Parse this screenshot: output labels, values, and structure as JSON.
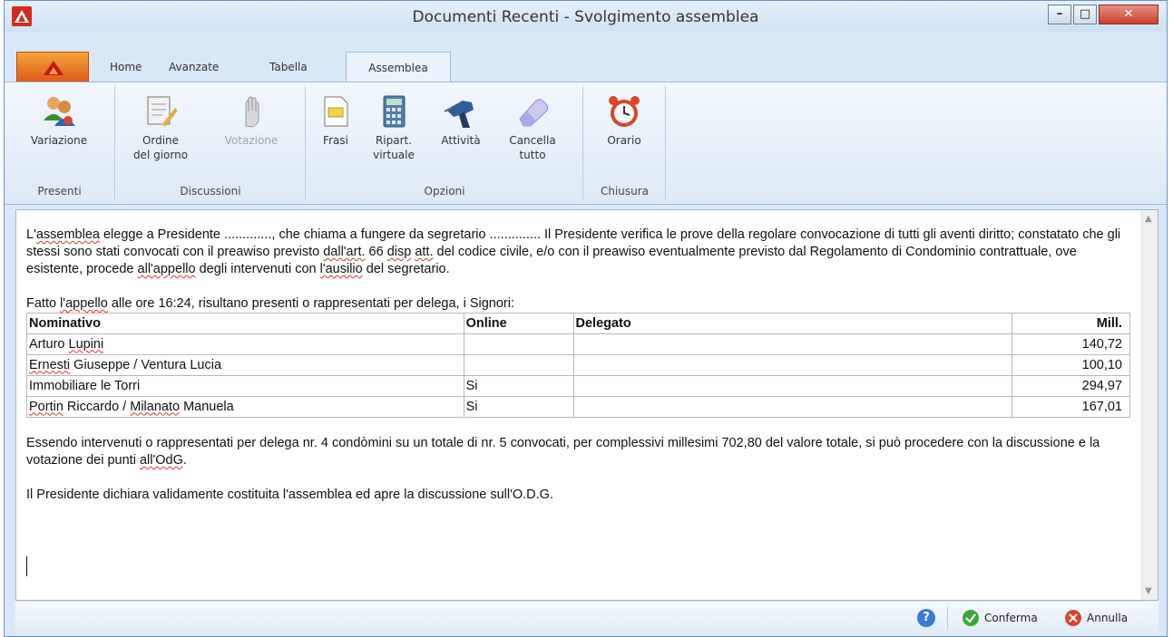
{
  "window": {
    "title": "Documenti Recenti - Svolgimento assemblea"
  },
  "tabs": {
    "home": "Home",
    "avanzate": "Avanzate",
    "tabella": "Tabella",
    "assemblea": "Assemblea"
  },
  "ribbon": {
    "presenti": {
      "label": "Presenti",
      "variazione": "Variazione"
    },
    "discussioni": {
      "label": "Discussioni",
      "ordine_l1": "Ordine",
      "ordine_l2": "del giorno",
      "votazione": "Votazione"
    },
    "opzioni": {
      "label": "Opzioni",
      "frasi": "Frasi",
      "ripart_l1": "Ripart.",
      "ripart_l2": "virtuale",
      "attivita": "Attività",
      "cancella_l1": "Cancella",
      "cancella_l2": "tutto"
    },
    "chiusura": {
      "label": "Chiusura",
      "orario": "Orario"
    }
  },
  "document": {
    "p1_a": "L'",
    "p1_b": "assemblea",
    "p1_c": " elegge a Presidente ............., che chiama a fungere da segretario .............. Il Presidente verifica le prove della regolare convocazione di tutti gli aventi diritto; constatato che gli stessi sono stati convocati con il preawiso previsto ",
    "p1_d": "dall'art.",
    "p1_e": " 66 ",
    "p1_f": "disp",
    "p1_g": " ",
    "p1_h": "att.",
    "p1_i": " del codice civile, e/o con il preawiso eventualmente previsto dal Regolamento di Condominio contrattuale, ove esistente, procede ",
    "p1_j": "all'appello",
    "p1_k": " degli intervenuti con ",
    "p1_l": "l'ausilio",
    "p1_m": " del segretario.",
    "p2_a": "Fatto ",
    "p2_b": "l'appello",
    "p2_c": " alle ore 16:24, risultano presenti o rappresentati per delega, i Signori:",
    "table": {
      "headers": [
        "Nominativo",
        "Online",
        "Delegato",
        "Mill."
      ],
      "rows": [
        {
          "n1": "Arturo ",
          "n2": "Lupini",
          "n3": "",
          "online": "",
          "delegato": "",
          "mill": "140,72"
        },
        {
          "n1": "",
          "n2": "Ernesti",
          "n3": " Giuseppe / Ventura Lucia",
          "online": "",
          "delegato": "",
          "mill": "100,10"
        },
        {
          "n1": "Immobiliare le Torri",
          "n2": "",
          "n3": "",
          "online": "Si",
          "delegato": "",
          "mill": "294,97"
        },
        {
          "n1": "",
          "n2": "Portin",
          "n3": " Riccardo / ",
          "n4": "Milanato",
          "n5": " Manuela",
          "online": "Si",
          "delegato": "",
          "mill": "167,01"
        }
      ]
    },
    "p3_a": "Essendo intervenuti o rappresentati per delega nr. 4 condòmini su un totale di nr. 5 convocati, per complessivi millesimi 702,80 del valore totale, si può procedere con la discussione e la votazione dei punti ",
    "p3_b": "all'OdG",
    "p3_c": ".",
    "p4": "Il Presidente dichiara validamente costituita l'assemblea ed apre la discussione sull'O.D.G."
  },
  "status": {
    "help": "?",
    "conferma": "Conferma",
    "annulla": "Annulla"
  },
  "colors": {
    "accent": "#d42a1e",
    "menu": "#ee7d22",
    "confirm": "#3aa83a",
    "cancel": "#d9442f"
  }
}
